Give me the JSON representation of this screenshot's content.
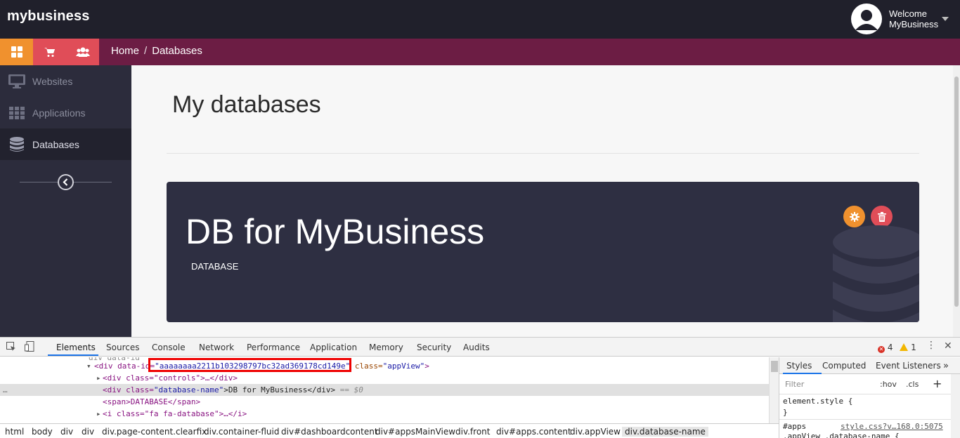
{
  "topbar": {
    "brand": "mybusiness",
    "welcome_line1": "Welcome",
    "welcome_line2": "MyBusiness",
    "avatar_icon": "user-avatar-icon"
  },
  "subnav": {
    "icons": [
      "dashboard-grid-icon",
      "cart-icon",
      "users-icon"
    ],
    "colors": {
      "orange": "#f0912e",
      "red": "#e04d58",
      "purple": "#6c1d44"
    },
    "breadcrumb": {
      "home": "Home",
      "separator": "/",
      "current": "Databases"
    }
  },
  "sidebar": {
    "items": [
      {
        "label": "Websites",
        "icon": "monitor-icon"
      },
      {
        "label": "Applications",
        "icon": "grid-icon"
      },
      {
        "label": "Databases",
        "icon": "database-icon",
        "active": true
      }
    ]
  },
  "main": {
    "title": "My databases",
    "card": {
      "name": "DB for MyBusiness",
      "type": "DATABASE"
    }
  },
  "devtools": {
    "tabs": [
      "Elements",
      "Sources",
      "Console",
      "Network",
      "Performance",
      "Application",
      "Memory",
      "Security",
      "Audits"
    ],
    "active_tab": "Elements",
    "errors": "4",
    "warnings": "1",
    "dom": {
      "line0": "div data-id",
      "line1_tag": "<div data-id=",
      "line1_id": "\"aaaaaaaa2211b103298797bc32ad369178cd149e\"",
      "line1_class_attr": " class=",
      "line1_class_val": "\"appView\"",
      "line2": "<div class=\"controls\">…</div>",
      "line3_tag": "<div class=",
      "line3_val": "\"database-name\"",
      "line3_text": ">DB for MyBusiness</div>",
      "line3_marker": " == $0",
      "line4": "<span>DATABASE</span>",
      "line5": "<i class=\"fa fa-database\">…</i>"
    },
    "crumbs": [
      "html",
      "body",
      "div",
      "div",
      "div.page-content.clearfix",
      "div.container-fluid",
      "div#dashboardcontent",
      "div#appsMainView",
      "div.front",
      "div#apps.content",
      "div.appView",
      "div.database-name"
    ],
    "styles": {
      "tabs": [
        "Styles",
        "Computed",
        "Event Listeners"
      ],
      "filter_placeholder": "Filter",
      "hov": ":hov",
      "cls": ".cls",
      "element_style": "element.style {",
      "close_brace": "}",
      "rule_selector": "#apps",
      "rule_selector2": ".appView .database-name {",
      "source_link": "style.css?v…168.0:5075"
    }
  }
}
